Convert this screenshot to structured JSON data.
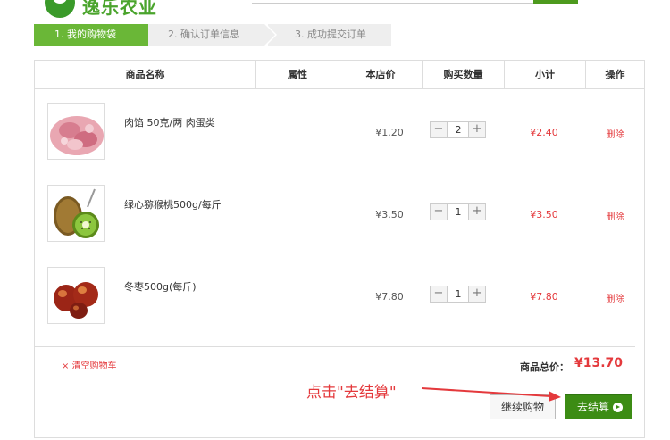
{
  "header": {
    "logo_text": "逸乐农业"
  },
  "steps": [
    {
      "label": "1. 我的购物袋",
      "active": true
    },
    {
      "label": "2. 确认订单信息",
      "active": false
    },
    {
      "label": "3. 成功提交订单",
      "active": false
    }
  ],
  "table": {
    "columns": [
      "商品名称",
      "属性",
      "本店价",
      "购买数量",
      "小计",
      "操作"
    ],
    "rows": [
      {
        "name": "肉馅 50克/两 肉蛋类",
        "price": "¥1.20",
        "qty": "2",
        "subtotal": "¥2.40",
        "action": "删除",
        "image": "minced-meat-image"
      },
      {
        "name": "绿心猕猴桃500g/每斤",
        "price": "¥3.50",
        "qty": "1",
        "subtotal": "¥3.50",
        "action": "删除",
        "image": "kiwi-image"
      },
      {
        "name": "冬枣500g(每斤)",
        "price": "¥7.80",
        "qty": "1",
        "subtotal": "¥7.80",
        "action": "删除",
        "image": "jujube-image"
      }
    ]
  },
  "footer": {
    "clear_cart": "× 清空购物车",
    "total_label": "商品总价：",
    "total_value": "¥13.70",
    "continue_label": "继续购物",
    "checkout_label": "去结算"
  },
  "annotation": {
    "text": "点击\"去结算\""
  },
  "colors": {
    "accent_green": "#6ab737",
    "button_green": "#3c8c14",
    "price_red": "#e4393c"
  }
}
